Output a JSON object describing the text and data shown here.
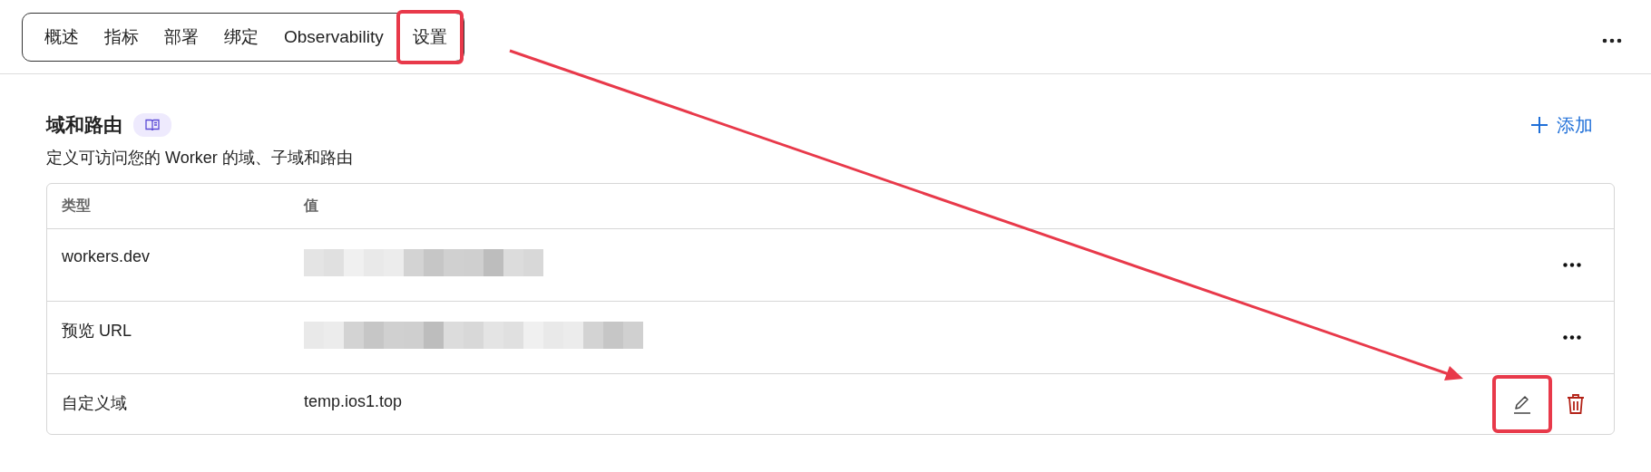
{
  "tabs": [
    {
      "label": "概述",
      "annotated": false
    },
    {
      "label": "指标",
      "annotated": false
    },
    {
      "label": "部署",
      "annotated": false
    },
    {
      "label": "绑定",
      "annotated": false
    },
    {
      "label": "Observability",
      "annotated": false
    },
    {
      "label": "设置",
      "annotated": true
    }
  ],
  "section": {
    "title": "域和路由",
    "description": "定义可访问您的 Worker 的域、子域和路由",
    "add_label": "添加"
  },
  "table": {
    "columns": [
      "类型",
      "值"
    ],
    "rows": [
      {
        "kind": "redacted",
        "type": "workers.dev",
        "annotated": false
      },
      {
        "kind": "redacted",
        "type": "预览 URL",
        "annotated": false
      },
      {
        "kind": "custom",
        "type": "自定义域",
        "value": "temp.ios1.top",
        "annotated": true
      }
    ]
  }
}
